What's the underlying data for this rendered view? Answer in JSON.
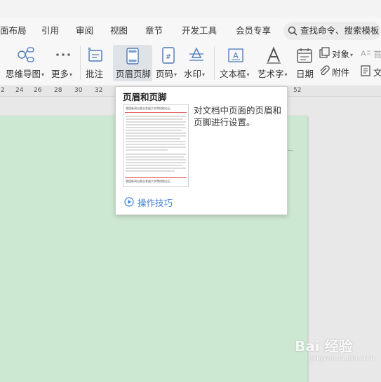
{
  "menubar": {
    "tabs": [
      "面布局",
      "引用",
      "审阅",
      "视图",
      "章节",
      "开发工具",
      "会员专享"
    ],
    "search_placeholder": "查找命令、搜索模板"
  },
  "ribbon": {
    "mindmap": "思维导图",
    "more": "更多",
    "comment": "批注",
    "header_footer": "页眉页脚",
    "page_number": "页码",
    "watermark": "水印",
    "textbox": "文本框",
    "wordart": "艺术字",
    "date": "日期",
    "object": "对象",
    "attachment": "附件",
    "first_letter": "首",
    "doc_part": "文"
  },
  "ruler": {
    "ticks": [
      "2",
      "24",
      "26",
      "28",
      "30",
      "32",
      "52"
    ]
  },
  "tooltip": {
    "title": "页眉和页脚",
    "thumb_header": "我国新闻出版业发展大学院校校论石",
    "thumb_footer": "我国新闻出版业发展大学院校校论石",
    "description": "对文档中页面的页眉和页脚进行设置。",
    "tips_link": "操作技巧"
  },
  "watermark": {
    "brand": "Bai 经验",
    "url": "jingyan.baidu.com"
  },
  "colors": {
    "page_background": "#cde8d2",
    "accent_link": "#3f7fd6",
    "selected_button": "#dfe3e8"
  }
}
